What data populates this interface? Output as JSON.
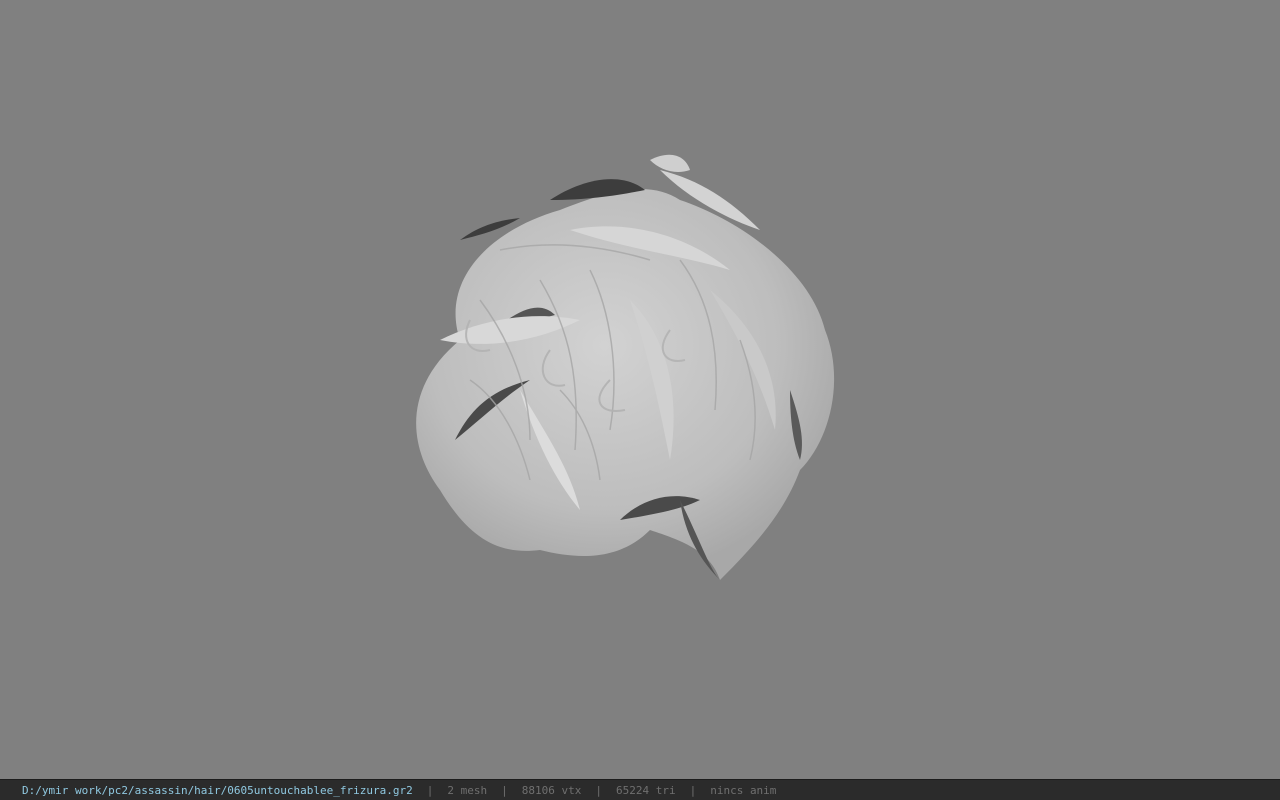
{
  "viewer": {
    "background_color": "#808080",
    "model_icon": "hair-mesh-icon"
  },
  "status": {
    "file_path": "D:/ymir work/pc2/assassin/hair/0605untouchablee_frizura.gr2",
    "separator": "|",
    "mesh_count": "2 mesh",
    "vertex_count": "88106 vtx",
    "triangle_count": "65224 tri",
    "anim_status": "nincs anim",
    "path_color": "#8fc8e0",
    "bar_color": "#2b2b2b"
  }
}
